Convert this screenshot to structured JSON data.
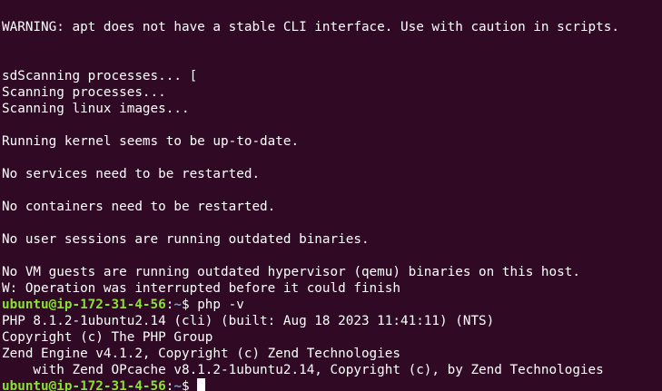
{
  "terminal": {
    "lines": [
      {
        "text": "WARNING: apt does not have a stable CLI interface. Use with caution in scripts."
      },
      {
        "text": ""
      },
      {
        "text": ""
      },
      {
        "text": "sdScanning processes... ["
      },
      {
        "text": "Scanning processes..."
      },
      {
        "text": "Scanning linux images..."
      },
      {
        "text": ""
      },
      {
        "text": "Running kernel seems to be up-to-date."
      },
      {
        "text": ""
      },
      {
        "text": "No services need to be restarted."
      },
      {
        "text": ""
      },
      {
        "text": "No containers need to be restarted."
      },
      {
        "text": ""
      },
      {
        "text": "No user sessions are running outdated binaries."
      },
      {
        "text": ""
      },
      {
        "text": "No VM guests are running outdated hypervisor (qemu) binaries on this host."
      },
      {
        "text": "W: Operation was interrupted before it could finish"
      }
    ],
    "prompt1": {
      "user_host": "ubuntu@ip-172-31-4-56",
      "colon": ":",
      "path": "~",
      "symbol": "$ ",
      "command": "php -v"
    },
    "output": [
      {
        "text": "PHP 8.1.2-1ubuntu2.14 (cli) (built: Aug 18 2023 11:41:11) (NTS)"
      },
      {
        "text": "Copyright (c) The PHP Group"
      },
      {
        "text": "Zend Engine v4.1.2, Copyright (c) Zend Technologies"
      },
      {
        "text": "    with Zend OPcache v8.1.2-1ubuntu2.14, Copyright (c), by Zend Technologies"
      }
    ],
    "prompt2": {
      "user_host": "ubuntu@ip-172-31-4-56",
      "colon": ":",
      "path": "~",
      "symbol": "$ "
    },
    "colors": {
      "background": "#300a24",
      "foreground": "#ffffff",
      "user_host": "#8ae234",
      "path": "#729fcf"
    }
  }
}
